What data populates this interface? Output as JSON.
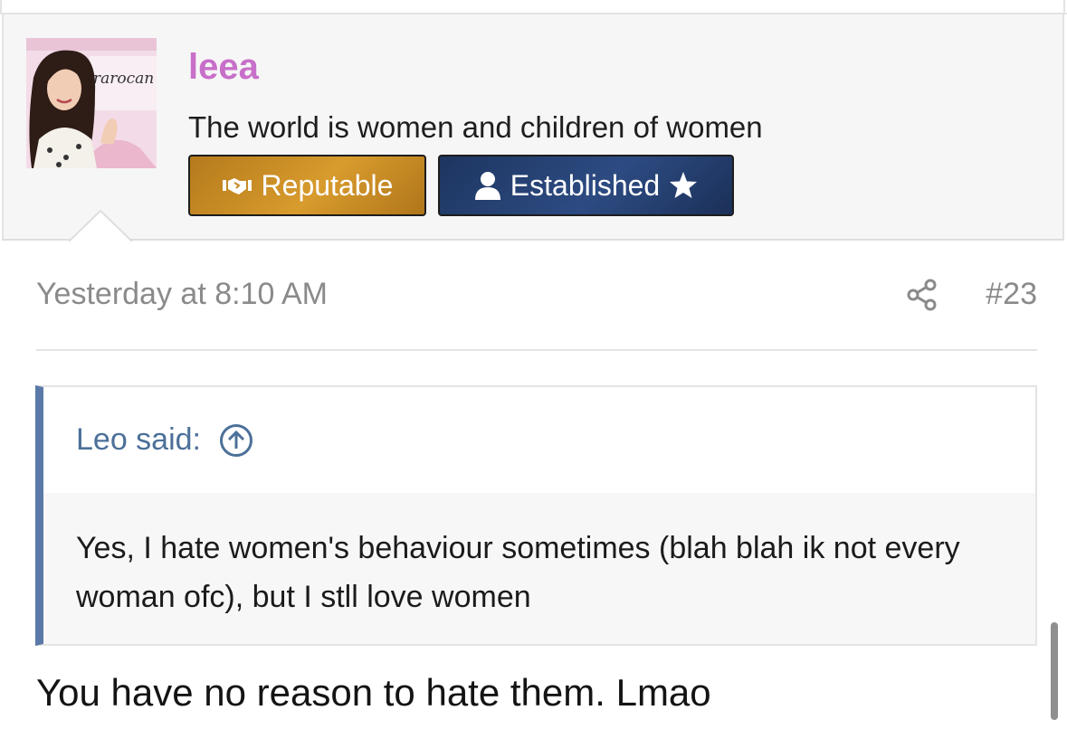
{
  "user": {
    "name": "leea",
    "title": "The world is women and children of women",
    "avatar_sign_text": "rarocan",
    "badges": [
      {
        "label": "Reputable",
        "icon": "handshake-icon",
        "color": "#c98a25"
      },
      {
        "label": "Established",
        "icon": "user-icon",
        "suffix_icon": "star-icon",
        "color": "#263f6e"
      }
    ]
  },
  "post": {
    "date": "Yesterday at 8:10 AM",
    "number": "#23",
    "share_icon": "share-icon"
  },
  "quote": {
    "author_line": "Leo said:",
    "jump_icon": "arrow-up-circle-icon",
    "text": "Yes, I hate women's behaviour sometimes (blah blah ik not every woman ofc), but I stll love women",
    "accent_color": "#5a79a8"
  },
  "message": {
    "text": "You have no reason to hate them. Lmao"
  },
  "colors": {
    "username": "#c86fc9",
    "meta_text": "#8a8a8a",
    "quote_author": "#4c7099"
  }
}
